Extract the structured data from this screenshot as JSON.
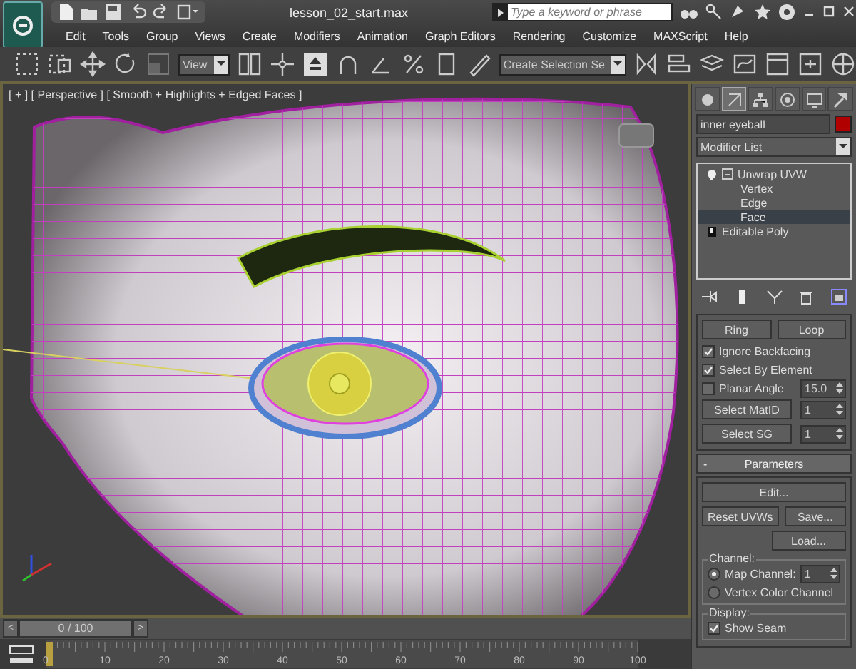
{
  "title_bar": {
    "title": "lesson_02_start.max",
    "search": {
      "placeholder": "Type a keyword or phrase"
    }
  },
  "menu": [
    "Edit",
    "Tools",
    "Group",
    "Views",
    "Create",
    "Modifiers",
    "Animation",
    "Graph Editors",
    "Rendering",
    "Customize",
    "MAXScript",
    "Help"
  ],
  "toolbar": {
    "view_dropdown": "View",
    "selection_set": "Create Selection Se"
  },
  "viewport": {
    "label": "[ + ] [ Perspective ] [ Smooth + Highlights + Edged Faces ]"
  },
  "command_panel": {
    "tabs": [
      {
        "kind": "create",
        "selected": false
      },
      {
        "kind": "modify",
        "selected": true
      },
      {
        "kind": "hierarchy",
        "selected": false
      },
      {
        "kind": "motion",
        "selected": false
      },
      {
        "kind": "display",
        "selected": false
      },
      {
        "kind": "utilities",
        "selected": false
      }
    ],
    "object_name": "inner eyeball",
    "modifier_list": "Modifier List",
    "stack": [
      {
        "label": "Unwrap UVW",
        "expanded": true,
        "selected": false,
        "children": [
          {
            "label": "Vertex",
            "selected": false
          },
          {
            "label": "Edge",
            "selected": false
          },
          {
            "label": "Face",
            "selected": true
          }
        ]
      },
      {
        "label": "Editable Poly",
        "selected": false
      }
    ],
    "selection_buttons": [
      "Ring",
      "Loop"
    ],
    "options": [
      {
        "label": "Ignore Backfacing",
        "checked": true
      },
      {
        "label": "Select By Element",
        "checked": true
      },
      {
        "label": "Planar Angle",
        "checked": false,
        "value": "15.0"
      }
    ],
    "select_rows": [
      {
        "button": "Select MatID",
        "value": "1"
      },
      {
        "button": "Select SG",
        "value": "1"
      }
    ],
    "parameters": {
      "collapse": "-",
      "title": "Parameters",
      "edit": "Edit...",
      "reset": "Reset UVWs",
      "save": "Save...",
      "load": "Load...",
      "channel": {
        "title": "Channel:",
        "options": [
          {
            "label": "Map Channel:",
            "selected": true,
            "value": "1"
          },
          {
            "label": "Vertex Color Channel",
            "selected": false
          }
        ]
      },
      "display": {
        "title": "Display:",
        "options": [
          {
            "label": "Show Seam",
            "checked": true
          }
        ]
      }
    }
  },
  "timeline": {
    "prev": "<",
    "position": "0 / 100",
    "next": ">",
    "level": 0,
    "ticks": [
      "0",
      "10",
      "20",
      "30",
      "40",
      "50",
      "60",
      "70",
      "80",
      "90",
      "100"
    ]
  }
}
